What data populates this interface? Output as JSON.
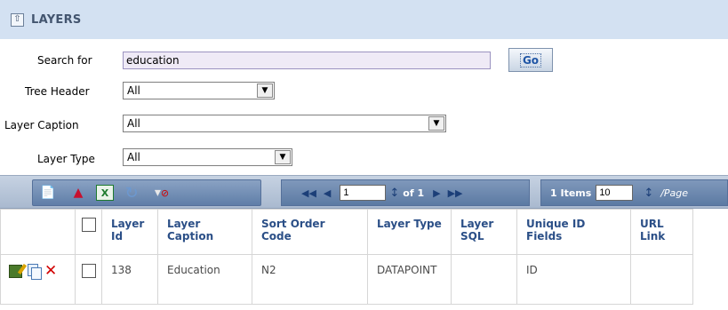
{
  "panel": {
    "title": "LAYERS",
    "collapse_icon": "collapse-up-icon"
  },
  "form": {
    "search_label": "Search for",
    "search_value": "education",
    "go_label": "Go",
    "tree_header_label": "Tree Header",
    "tree_header_value": "All",
    "layer_caption_label": "Layer Caption",
    "layer_caption_value": "All",
    "layer_type_label": "Layer Type",
    "layer_type_value": "All"
  },
  "toolbar": {
    "icons": [
      "new-document-icon",
      "pdf-export-icon",
      "excel-export-icon",
      "refresh-icon",
      "clear-filter-icon"
    ],
    "current_page": "1",
    "of_text": "of 1",
    "items_text": "1 Items",
    "per_page_value": "10",
    "per_page_label": "/Page"
  },
  "grid": {
    "columns": [
      "Layer Id",
      "Layer Caption",
      "Sort Order Code",
      "Layer Type",
      "Layer SQL",
      "Unique ID Fields",
      "URL Link"
    ],
    "rows": [
      {
        "layer_id": "138",
        "layer_caption": "Education",
        "sort_order_code": "N2",
        "layer_type": "DATAPOINT",
        "layer_sql": "",
        "unique_id_fields": "ID",
        "url_link": ""
      }
    ]
  }
}
